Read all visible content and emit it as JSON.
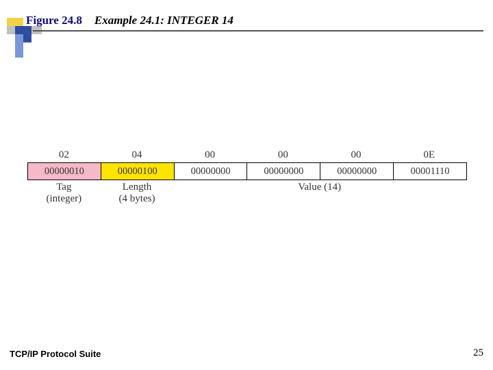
{
  "header": {
    "figure_label": "Figure 24.8",
    "figure_title": "Example 24.1: INTEGER 14"
  },
  "diagram": {
    "cells": [
      {
        "hex": "02",
        "bin": "00000010",
        "color": "pink"
      },
      {
        "hex": "04",
        "bin": "00000100",
        "color": "yellow"
      },
      {
        "hex": "00",
        "bin": "00000000",
        "color": "none"
      },
      {
        "hex": "00",
        "bin": "00000000",
        "color": "none"
      },
      {
        "hex": "00",
        "bin": "00000000",
        "color": "none"
      },
      {
        "hex": "0E",
        "bin": "00001110",
        "color": "none"
      }
    ],
    "labels": {
      "tag_main": "Tag",
      "tag_sub": "(integer)",
      "len_main": "Length",
      "len_sub": "(4 bytes)",
      "value": "Value (14)"
    }
  },
  "footer": {
    "book": "TCP/IP Protocol Suite",
    "page": "25"
  }
}
